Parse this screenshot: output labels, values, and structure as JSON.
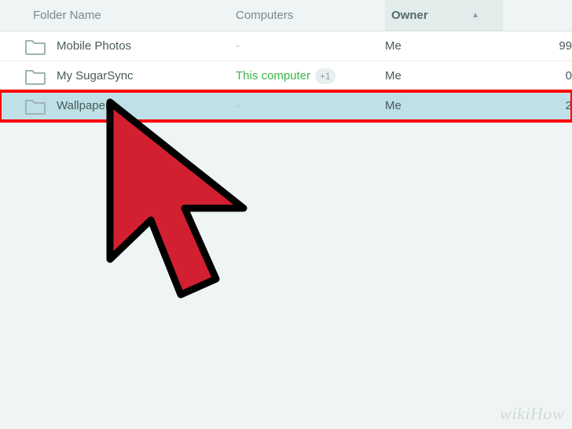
{
  "columns": {
    "folder_name": "Folder Name",
    "computers": "Computers",
    "owner": "Owner",
    "sort_indicator": "▲"
  },
  "rows": [
    {
      "name": "Mobile Photos",
      "computers": "-",
      "computers_active": false,
      "plus": null,
      "owner": "Me",
      "count": "99",
      "selected": false,
      "highlighted": false
    },
    {
      "name": "My SugarSync",
      "computers": "This computer",
      "computers_active": true,
      "plus": "+1",
      "owner": "Me",
      "count": "0",
      "selected": false,
      "highlighted": false
    },
    {
      "name": "Wallpaper",
      "computers": "-",
      "computers_active": false,
      "plus": null,
      "owner": "Me",
      "count": "2",
      "selected": true,
      "highlighted": true
    }
  ],
  "watermark": "wikiHow"
}
